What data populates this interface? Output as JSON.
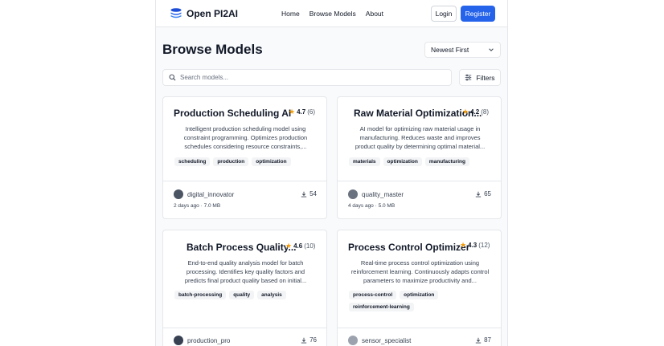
{
  "app": {
    "name": "Open PI2AI"
  },
  "nav": {
    "home": "Home",
    "browse": "Browse Models",
    "about": "About"
  },
  "auth": {
    "login": "Login",
    "register": "Register"
  },
  "page": {
    "title": "Browse Models"
  },
  "sort": {
    "selected": "Newest First"
  },
  "search": {
    "placeholder": "Search models..."
  },
  "filters": {
    "label": "Filters"
  },
  "colors": {
    "accent": "#2563eb",
    "star": "#f59e0b"
  },
  "models": [
    {
      "title": "Production Scheduling AI",
      "rating": "4.7",
      "rating_count": "(6)",
      "description": "Intelligent production scheduling model using constraint programming. Optimizes production schedules considering resource constraints,...",
      "tags": [
        "scheduling",
        "production",
        "optimization"
      ],
      "author": "digital_innovator",
      "downloads": "54",
      "meta": "2 days ago · 7.0 MB"
    },
    {
      "title": "Raw Material Optimization...",
      "rating": "4.2",
      "rating_count": "(8)",
      "description": "AI model for optimizing raw material usage in manufacturing. Reduces waste and improves product quality by determining optimal material...",
      "tags": [
        "materials",
        "optimization",
        "manufacturing"
      ],
      "author": "quality_master",
      "downloads": "65",
      "meta": "4 days ago · 5.0 MB"
    },
    {
      "title": "Batch Process Quality...",
      "rating": "4.6",
      "rating_count": "(10)",
      "description": "End-to-end quality analysis model for batch processing. Identifies key quality factors and predicts final product quality based on initial...",
      "tags": [
        "batch-processing",
        "quality",
        "analysis"
      ],
      "author": "production_pro",
      "downloads": "76",
      "meta": ""
    },
    {
      "title": "Process Control Optimizer",
      "rating": "4.3",
      "rating_count": "(12)",
      "description": "Real-time process control optimization using reinforcement learning. Continuously adapts control parameters to maximize productivity and...",
      "tags": [
        "process-control",
        "optimization",
        "reinforcement-learning"
      ],
      "author": "sensor_specialist",
      "downloads": "87",
      "meta": ""
    }
  ]
}
